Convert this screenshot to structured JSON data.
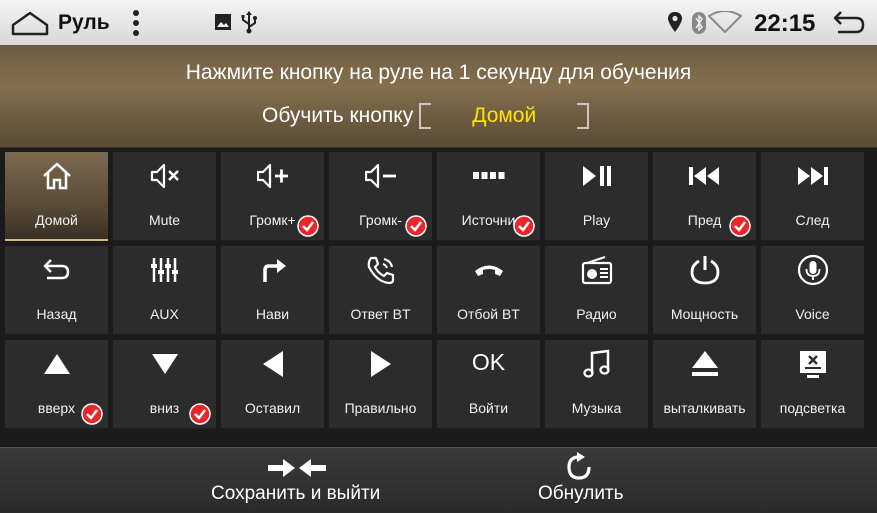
{
  "statusbar": {
    "title": "Руль",
    "time": "22:15",
    "icons": [
      "home-icon",
      "more-vert-icon",
      "image-icon",
      "usb-icon",
      "location-icon",
      "bluetooth-icon",
      "wifi-icon",
      "back-icon"
    ]
  },
  "header": {
    "instruction": "Нажмите кнопку на руле на 1 секунду для обучения",
    "learn_label": "Обучить кнопку",
    "learn_value": "Домой",
    "value_color": "#ffe400"
  },
  "buttons": [
    {
      "label": "Домой",
      "icon": "home-icon",
      "checked": false,
      "active": true
    },
    {
      "label": "Mute",
      "icon": "mute-icon",
      "checked": false
    },
    {
      "label": "Громк+",
      "icon": "volume-up-icon",
      "checked": true
    },
    {
      "label": "Громк-",
      "icon": "volume-down-icon",
      "checked": true
    },
    {
      "label": "Источни",
      "icon": "source-icon",
      "checked": true
    },
    {
      "label": "Play",
      "icon": "play-pause-icon",
      "checked": false
    },
    {
      "label": "Пред",
      "icon": "previous-icon",
      "checked": true
    },
    {
      "label": "След",
      "icon": "next-icon",
      "checked": false
    },
    {
      "label": "Назад",
      "icon": "return-icon",
      "checked": false
    },
    {
      "label": "AUX",
      "icon": "equalizer-icon",
      "checked": false
    },
    {
      "label": "Нави",
      "icon": "navigation-turn-icon",
      "checked": false
    },
    {
      "label": "Ответ BT",
      "icon": "phone-answer-icon",
      "checked": false
    },
    {
      "label": "Отбой BT",
      "icon": "phone-hangup-icon",
      "checked": false
    },
    {
      "label": "Радио",
      "icon": "radio-icon",
      "checked": false
    },
    {
      "label": "Мощность",
      "icon": "power-icon",
      "checked": false
    },
    {
      "label": "Voice",
      "icon": "microphone-icon",
      "checked": false
    },
    {
      "label": "вверх",
      "icon": "triangle-up-icon",
      "checked": true
    },
    {
      "label": "вниз",
      "icon": "triangle-down-icon",
      "checked": true
    },
    {
      "label": "Оставил",
      "icon": "triangle-left-icon",
      "checked": false
    },
    {
      "label": "Правильно",
      "icon": "triangle-right-icon",
      "checked": false
    },
    {
      "label": "Войти",
      "icon": "ok-icon",
      "icon_text": "OK",
      "checked": false
    },
    {
      "label": "Музыка",
      "icon": "music-note-icon",
      "checked": false
    },
    {
      "label": "выталкивать",
      "icon": "eject-icon",
      "checked": false
    },
    {
      "label": "подсветка",
      "icon": "backlight-icon",
      "checked": false
    }
  ],
  "footer": {
    "save_label": "Сохранить и выйти",
    "reset_label": "Обнулить"
  },
  "colors": {
    "check": "#e8262b",
    "accent": "#d8b878"
  }
}
